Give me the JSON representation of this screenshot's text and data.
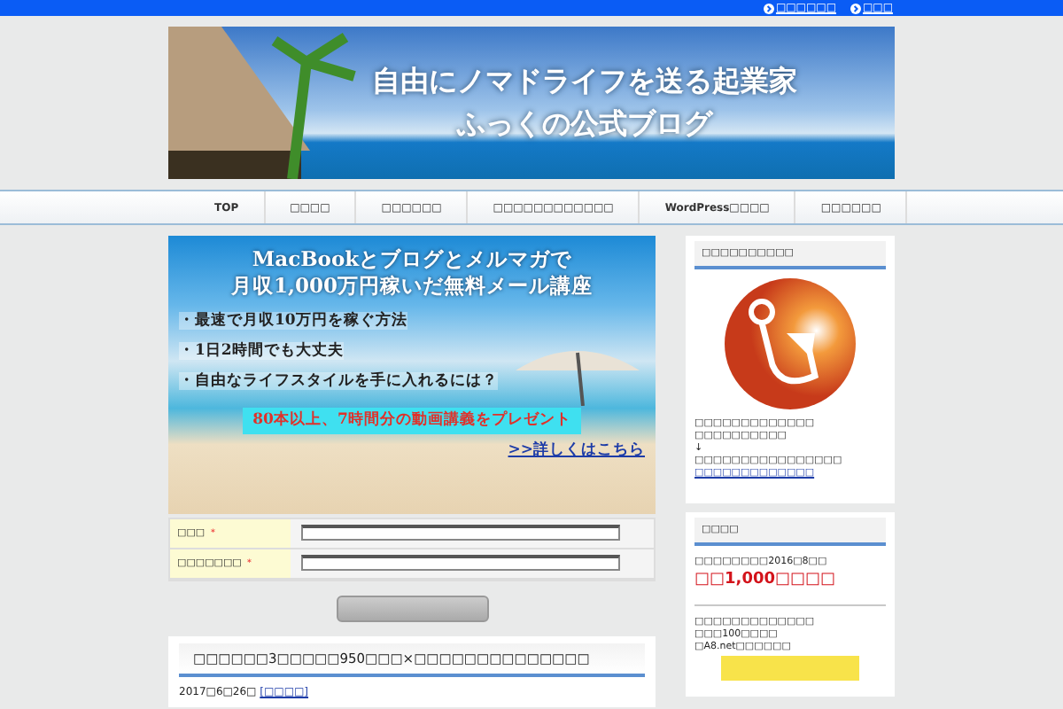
{
  "top_links": [
    "□□□□□□",
    "□□□"
  ],
  "header": {
    "title_lines": [
      "自由にノマドライフを送る起業家",
      "ふっくの公式ブログ"
    ]
  },
  "nav": [
    {
      "label": "TOP"
    },
    {
      "label": "□□□□"
    },
    {
      "label": "□□□□□□"
    },
    {
      "label": "□□□□□□□□□□□□"
    },
    {
      "label": "WordPress□□□□"
    },
    {
      "label": "□□□□□□"
    }
  ],
  "promo": {
    "headline": [
      "MacBookとブログとメルマガで",
      "月収1,000万円稼いだ無料メール講座"
    ],
    "bullets": [
      "・最速で月収10万円を稼ぐ方法",
      "・1日2時間でも大丈夫",
      "・自由なライフスタイルを手に入れるには？"
    ],
    "present": "80本以上、7時間分の動画講義をプレゼント",
    "details_link": ">>詳しくはこちら"
  },
  "form": {
    "fields": [
      {
        "label": "□□□",
        "required_mark": "＊"
      },
      {
        "label": "□□□□□□□",
        "required_mark": "＊"
      }
    ]
  },
  "post": {
    "title": "□□□□□□3□□□□□950□□□×□□□□□□□□□□□□□□",
    "meta": "2017□6□26□",
    "category": "[□□□□]"
  },
  "sidebar": {
    "profile": {
      "title": "□□□□□□□□□□",
      "lines": [
        "□□□□□□□□□□□□□",
        "□□□□□□□□□□",
        "↓",
        "□□□□□□□□□□□□□□□□"
      ],
      "link": "□□□□□□□□□□□□□"
    },
    "widget2": {
      "title": "□□□□",
      "line": "□□□□□□□□2016□8□□",
      "amount": "□□1,000□□□□",
      "lines": [
        "□□□□□□□□□□□□□",
        "□□□100□□□□",
        "□A8.net□□□□□□"
      ]
    }
  }
}
